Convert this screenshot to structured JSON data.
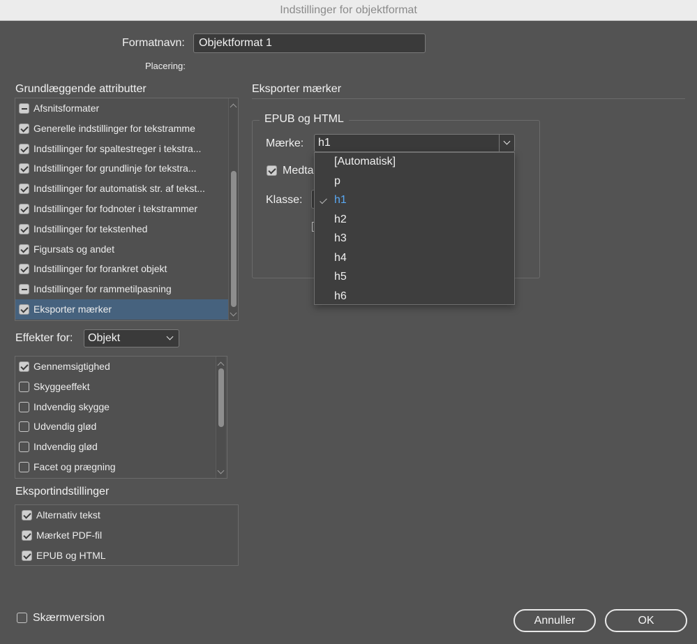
{
  "window": {
    "title": "Indstillinger for objektformat"
  },
  "format": {
    "name_label": "Formatnavn:",
    "name_value": "Objektformat 1",
    "placement_label": "Placering:"
  },
  "basic": {
    "heading": "Grundlæggende attributter",
    "items": [
      {
        "label": "Afsnitsformater",
        "state": "mixed"
      },
      {
        "label": "Generelle indstillinger for tekstramme",
        "state": "on"
      },
      {
        "label": "Indstillinger for spaltestreger i tekstra...",
        "state": "on"
      },
      {
        "label": "Indstillinger for grundlinje for tekstra...",
        "state": "on"
      },
      {
        "label": "Indstillinger for automatisk str. af tekst...",
        "state": "on"
      },
      {
        "label": "Indstillinger for fodnoter i tekstrammer",
        "state": "on"
      },
      {
        "label": "Indstillinger for tekstenhed",
        "state": "on"
      },
      {
        "label": "Figursats og andet",
        "state": "on"
      },
      {
        "label": "Indstillinger for forankret objekt",
        "state": "on"
      },
      {
        "label": "Indstillinger for rammetilpasning",
        "state": "mixed"
      },
      {
        "label": "Eksporter mærker",
        "state": "on",
        "selected": true
      }
    ]
  },
  "effects": {
    "label": "Effekter for:",
    "target_value": "Objekt",
    "items": [
      {
        "label": "Gennemsigtighed",
        "state": "on"
      },
      {
        "label": "Skyggeeffekt",
        "state": "off"
      },
      {
        "label": "Indvendig skygge",
        "state": "off"
      },
      {
        "label": "Udvendig glød",
        "state": "off"
      },
      {
        "label": "Indvendig glød",
        "state": "off"
      },
      {
        "label": "Facet og prægning",
        "state": "off"
      }
    ]
  },
  "export_settings": {
    "heading": "Eksportindstillinger",
    "items": [
      {
        "label": "Alternativ tekst",
        "state": "on"
      },
      {
        "label": "Mærket PDF-fil",
        "state": "on"
      },
      {
        "label": "EPUB og HTML",
        "state": "on"
      }
    ]
  },
  "right": {
    "heading": "Eksporter mærker",
    "group_title": "EPUB og HTML",
    "tag_label": "Mærke:",
    "tag_value": "h1",
    "include_label_partial": "Medta",
    "class_label": "Klasse:",
    "dropdown_options": [
      "[Automatisk]",
      "p",
      "h1",
      "h2",
      "h3",
      "h4",
      "h5",
      "h6"
    ],
    "dropdown_selected": "h1",
    "selected_color": "#5aa8f2"
  },
  "footer": {
    "screen_version_label": "Skærmversion",
    "cancel_label": "Annuller",
    "ok_label": "OK"
  }
}
